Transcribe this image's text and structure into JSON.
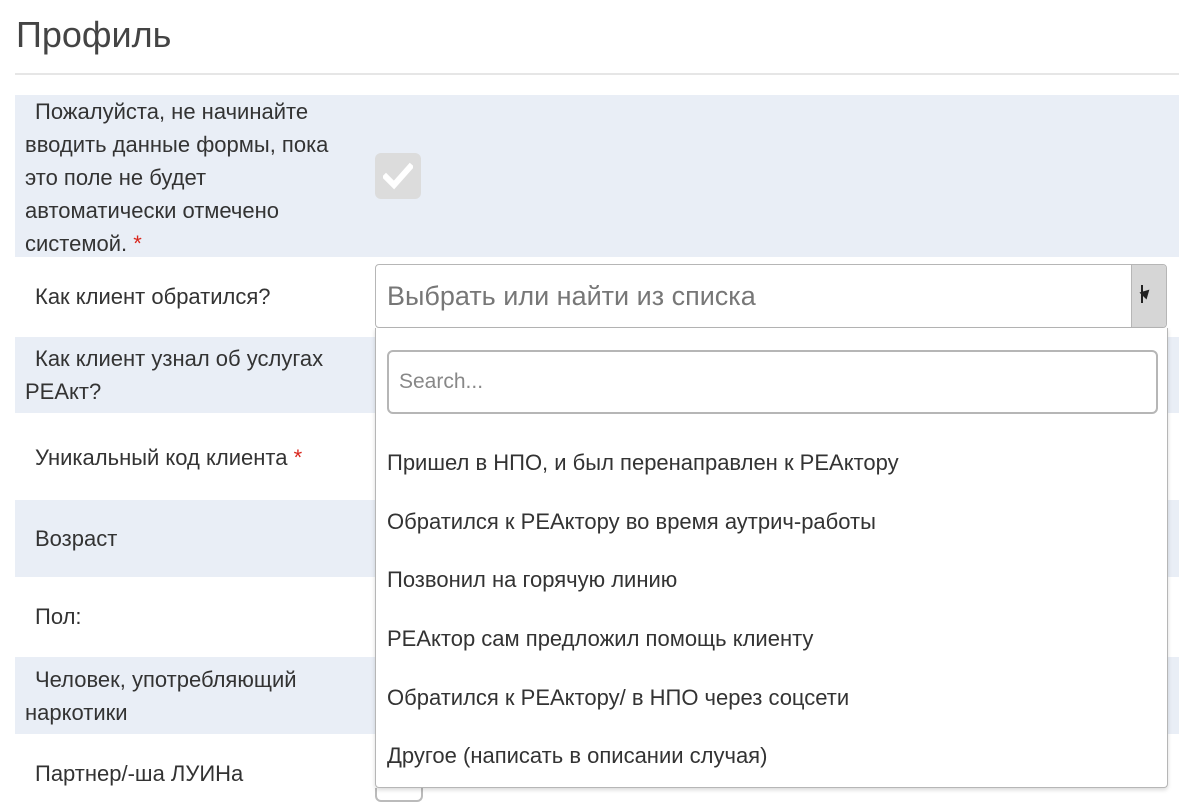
{
  "page": {
    "title": "Профиль"
  },
  "form": {
    "auto_check": {
      "label_line1": "Пожалуйста, не начинайте",
      "label_rest": [
        "вводить данные формы, пока",
        "это поле не будет",
        "автоматически отмечено"
      ],
      "label_last": "системой.",
      "required_mark": "*",
      "checked": true
    },
    "contact_method": {
      "label": "Как клиент обратился?"
    },
    "heard_about": {
      "line1": "Как клиент узнал об услугах",
      "line2": "РЕАкт?"
    },
    "client_code": {
      "label": "Уникальный код клиента",
      "required_mark": "*"
    },
    "age": {
      "label": "Возраст"
    },
    "gender": {
      "label": "Пол:"
    },
    "drug_user": {
      "line1": "Человек, употребляющий",
      "line2": "наркотики"
    },
    "partner": {
      "label": "Партнер/-ша ЛУИНа"
    }
  },
  "select": {
    "placeholder": "Выбрать или найти из списка",
    "search_placeholder": "Search...",
    "options": [
      "Пришел в НПО, и был перенаправлен к РЕАктору",
      "Обратился к РЕАктору во время аутрич-работы",
      "Позвонил на горячую линию",
      "РЕАктор сам предложил помощь клиенту",
      "Обратился к РЕАктору/ в НПО через соцсети",
      "Другое (написать в описании случая)"
    ]
  },
  "colors": {
    "row_shade": "#e9eef6",
    "required": "#d9261c"
  }
}
